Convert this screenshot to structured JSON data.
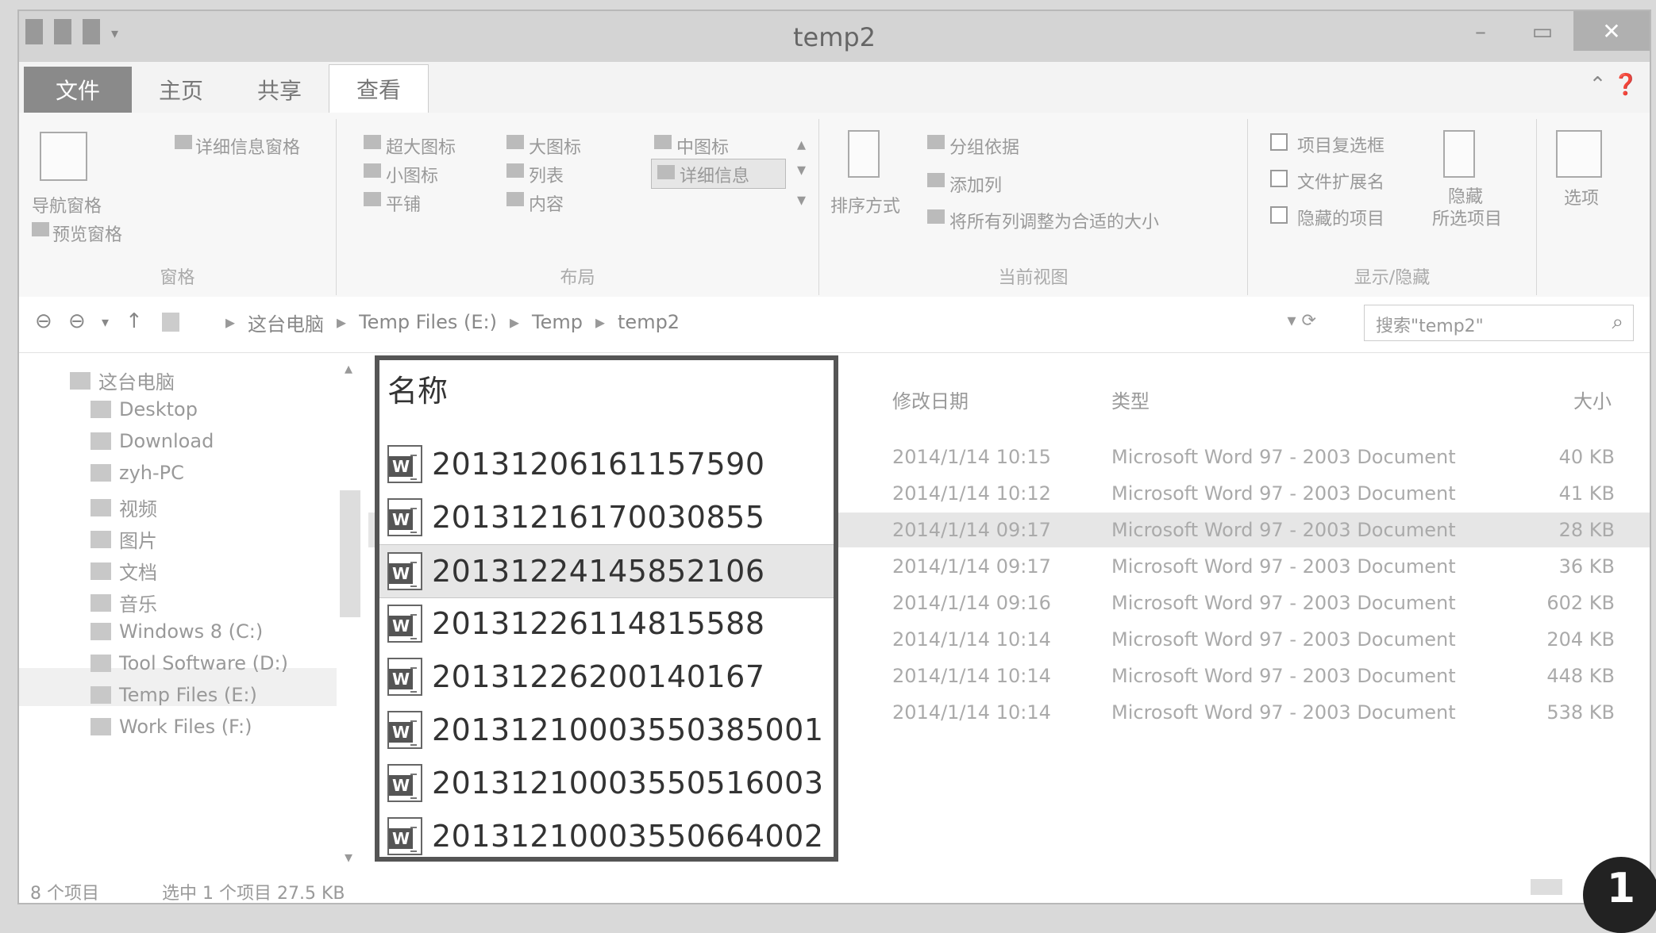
{
  "window": {
    "title": "temp2"
  },
  "tabs": [
    "文件",
    "主页",
    "共享",
    "查看"
  ],
  "ribbon": {
    "panes": {
      "nav_pane": "导航窗格",
      "preview_pane": "预览窗格",
      "details_pane": "详细信息窗格",
      "label": "窗格"
    },
    "layout": {
      "xl_icons": "超大图标",
      "l_icons": "大图标",
      "m_icons": "中图标",
      "s_icons": "小图标",
      "list": "列表",
      "details": "详细信息",
      "tiles": "平铺",
      "content": "内容",
      "label": "布局"
    },
    "current_view": {
      "sort_by": "排序方式",
      "group_by": "分组依据",
      "add_columns": "添加列",
      "size_all_columns": "将所有列调整为合适的大小",
      "label": "当前视图"
    },
    "show_hide": {
      "item_checkboxes": "项目复选框",
      "file_ext": "文件扩展名",
      "hidden_items": "隐藏的项目",
      "hide_selected": "隐藏",
      "hide_selected_2": "所选项目",
      "label": "显示/隐藏"
    },
    "options": "选项"
  },
  "address": {
    "crumbs": [
      "这台电脑",
      "Temp Files (E:)",
      "Temp",
      "temp2"
    ],
    "search_placeholder": "搜索\"temp2\""
  },
  "nav": {
    "items": [
      "这台电脑",
      "Desktop",
      "Download",
      "zyh-PC",
      "视频",
      "图片",
      "文档",
      "音乐",
      "Windows 8 (C:)",
      "Tool Software (D:)",
      "Temp Files (E:)",
      "Work Files (F:)"
    ]
  },
  "columns": {
    "name": "名称",
    "date": "修改日期",
    "type": "类型",
    "size": "大小"
  },
  "files": [
    {
      "name": "20131206161157590",
      "date": "2014/1/14 10:15",
      "type": "Microsoft Word 97 - 2003 Document",
      "size": "40 KB"
    },
    {
      "name": "20131216170030855",
      "date": "2014/1/14 10:12",
      "type": "Microsoft Word 97 - 2003 Document",
      "size": "41 KB"
    },
    {
      "name": "20131224145852106",
      "date": "2014/1/14 09:17",
      "type": "Microsoft Word 97 - 2003 Document",
      "size": "28 KB"
    },
    {
      "name": "20131226114815588",
      "date": "2014/1/14 09:17",
      "type": "Microsoft Word 97 - 2003 Document",
      "size": "36 KB"
    },
    {
      "name": "20131226200140167",
      "date": "2014/1/14 09:16",
      "type": "Microsoft Word 97 - 2003 Document",
      "size": "602 KB"
    },
    {
      "name": "2013121000355038500​1",
      "date": "2014/1/14 10:14",
      "type": "Microsoft Word 97 - 2003 Document",
      "size": "204 KB"
    },
    {
      "name": "20131210003550516003",
      "date": "2014/1/14 10:14",
      "type": "Microsoft Word 97 - 2003 Document",
      "size": "448 KB"
    },
    {
      "name": "20131210003550664002",
      "date": "2014/1/14 10:14",
      "type": "Microsoft Word 97 - 2003 Document",
      "size": "538 KB"
    }
  ],
  "status": {
    "count": "8 个项目",
    "selected": "选中 1 个项目 27.5 KB"
  },
  "badge": "1"
}
